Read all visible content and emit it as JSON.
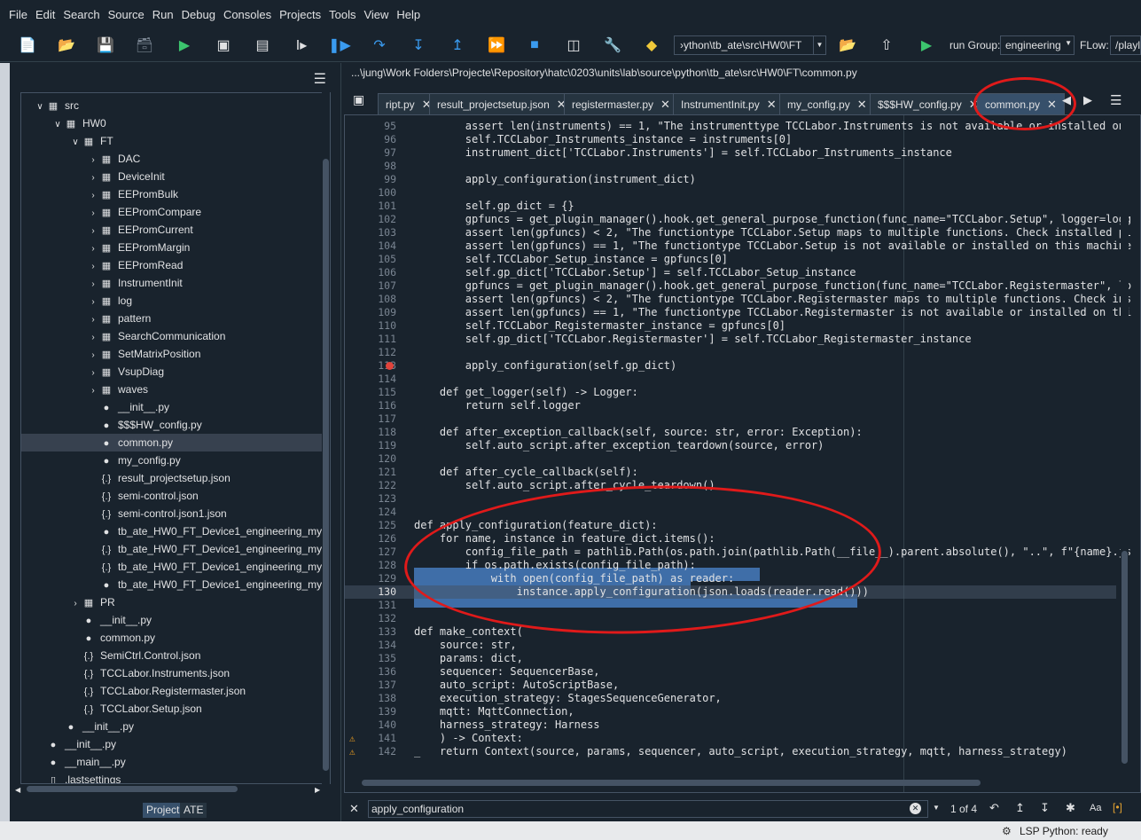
{
  "menu": [
    "File",
    "Edit",
    "Search",
    "Source",
    "Run",
    "Debug",
    "Consoles",
    "Projects",
    "Tools",
    "View",
    "Help"
  ],
  "toolbar": {
    "path": "›ython\\tb_ate\\src\\HW0\\FT",
    "run_group_label": "run Group:",
    "run_group_value": "engineering",
    "flow_label": "FLow:",
    "flow_value": "/playlis"
  },
  "tree": [
    {
      "label": "src",
      "indent": 1,
      "chev": "v",
      "icon": "folder"
    },
    {
      "label": "HW0",
      "indent": 2,
      "chev": "v",
      "icon": "folder"
    },
    {
      "label": "FT",
      "indent": 3,
      "chev": "v",
      "icon": "folder"
    },
    {
      "label": "DAC",
      "indent": 4,
      "chev": ">",
      "icon": "folder"
    },
    {
      "label": "DeviceInit",
      "indent": 4,
      "chev": ">",
      "icon": "folder"
    },
    {
      "label": "EEPromBulk",
      "indent": 4,
      "chev": ">",
      "icon": "folder"
    },
    {
      "label": "EEPromCompare",
      "indent": 4,
      "chev": ">",
      "icon": "folder"
    },
    {
      "label": "EEPromCurrent",
      "indent": 4,
      "chev": ">",
      "icon": "folder"
    },
    {
      "label": "EEPromMargin",
      "indent": 4,
      "chev": ">",
      "icon": "folder"
    },
    {
      "label": "EEPromRead",
      "indent": 4,
      "chev": ">",
      "icon": "folder"
    },
    {
      "label": "InstrumentInit",
      "indent": 4,
      "chev": ">",
      "icon": "folder"
    },
    {
      "label": "log",
      "indent": 4,
      "chev": ">",
      "icon": "folder"
    },
    {
      "label": "pattern",
      "indent": 4,
      "chev": ">",
      "icon": "folder"
    },
    {
      "label": "SearchCommunication",
      "indent": 4,
      "chev": ">",
      "icon": "folder"
    },
    {
      "label": "SetMatrixPosition",
      "indent": 4,
      "chev": ">",
      "icon": "folder"
    },
    {
      "label": "VsupDiag",
      "indent": 4,
      "chev": ">",
      "icon": "folder"
    },
    {
      "label": "waves",
      "indent": 4,
      "chev": ">",
      "icon": "folder"
    },
    {
      "label": "__init__.py",
      "indent": 4,
      "chev": "",
      "icon": "py"
    },
    {
      "label": "$$$HW_config.py",
      "indent": 4,
      "chev": "",
      "icon": "py"
    },
    {
      "label": "common.py",
      "indent": 4,
      "chev": "",
      "icon": "py",
      "selected": true
    },
    {
      "label": "my_config.py",
      "indent": 4,
      "chev": "",
      "icon": "py"
    },
    {
      "label": "result_projectsetup.json",
      "indent": 4,
      "chev": "",
      "icon": "json"
    },
    {
      "label": "semi-control.json",
      "indent": 4,
      "chev": "",
      "icon": "json"
    },
    {
      "label": "semi-control.json1.json",
      "indent": 4,
      "chev": "",
      "icon": "json"
    },
    {
      "label": "tb_ate_HW0_FT_Device1_engineering_myp",
      "indent": 4,
      "chev": "",
      "icon": "py"
    },
    {
      "label": "tb_ate_HW0_FT_Device1_engineering_myp",
      "indent": 4,
      "chev": "",
      "icon": "json"
    },
    {
      "label": "tb_ate_HW0_FT_Device1_engineering_myp",
      "indent": 4,
      "chev": "",
      "icon": "json"
    },
    {
      "label": "tb_ate_HW0_FT_Device1_engineering_myp",
      "indent": 4,
      "chev": "",
      "icon": "py"
    },
    {
      "label": "PR",
      "indent": 3,
      "chev": ">",
      "icon": "folder"
    },
    {
      "label": "__init__.py",
      "indent": 3,
      "chev": "",
      "icon": "py"
    },
    {
      "label": "common.py",
      "indent": 3,
      "chev": "",
      "icon": "py"
    },
    {
      "label": "SemiCtrl.Control.json",
      "indent": 3,
      "chev": "",
      "icon": "json"
    },
    {
      "label": "TCCLabor.Instruments.json",
      "indent": 3,
      "chev": "",
      "icon": "json"
    },
    {
      "label": "TCCLabor.Registermaster.json",
      "indent": 3,
      "chev": "",
      "icon": "json"
    },
    {
      "label": "TCCLabor.Setup.json",
      "indent": 3,
      "chev": "",
      "icon": "json"
    },
    {
      "label": "__init__.py",
      "indent": 2,
      "chev": "",
      "icon": "py"
    },
    {
      "label": "__init__.py",
      "indent": 1,
      "chev": "",
      "icon": "py"
    },
    {
      "label": "__main__.py",
      "indent": 1,
      "chev": "",
      "icon": "py"
    },
    {
      "label": ".lastsettings",
      "indent": 1,
      "chev": "",
      "icon": "file"
    }
  ],
  "panel_tabs": [
    "Project",
    "ATE"
  ],
  "editor": {
    "path": "...\\jung\\Work Folders\\Projecte\\Repository\\hatc\\0203\\units\\lab\\source\\python\\tb_ate\\src\\HW0\\FT\\common.py",
    "tabs": [
      {
        "label": "ript.py"
      },
      {
        "label": "result_projectsetup.json"
      },
      {
        "label": "registermaster.py"
      },
      {
        "label": "InstrumentInit.py"
      },
      {
        "label": "my_config.py"
      },
      {
        "label": "$$$HW_config.py"
      },
      {
        "label": "common.py",
        "active": true
      }
    ],
    "lines": [
      {
        "n": "95",
        "t": "        assert len(instruments) == 1, \"The instrumenttype TCCLabor.Instruments is not available or installed on"
      },
      {
        "n": "96",
        "t": "        self.TCCLabor_Instruments_instance = instruments[0]"
      },
      {
        "n": "97",
        "t": "        instrument_dict['TCCLabor.Instruments'] = self.TCCLabor_Instruments_instance"
      },
      {
        "n": "98",
        "t": ""
      },
      {
        "n": "99",
        "t": "        apply_configuration(instrument_dict)"
      },
      {
        "n": "100",
        "t": ""
      },
      {
        "n": "101",
        "t": "        self.gp_dict = {}"
      },
      {
        "n": "102",
        "t": "        gpfuncs = get_plugin_manager().hook.get_general_purpose_function(func_name=\"TCCLabor.Setup\", logger=logg"
      },
      {
        "n": "103",
        "t": "        assert len(gpfuncs) < 2, \"The functiontype TCCLabor.Setup maps to multiple functions. Check installed pl"
      },
      {
        "n": "104",
        "t": "        assert len(gpfuncs) == 1, \"The functiontype TCCLabor.Setup is not available or installed on this machine"
      },
      {
        "n": "105",
        "t": "        self.TCCLabor_Setup_instance = gpfuncs[0]"
      },
      {
        "n": "106",
        "t": "        self.gp_dict['TCCLabor.Setup'] = self.TCCLabor_Setup_instance"
      },
      {
        "n": "107",
        "t": "        gpfuncs = get_plugin_manager().hook.get_general_purpose_function(func_name=\"TCCLabor.Registermaster\", lo"
      },
      {
        "n": "108",
        "t": "        assert len(gpfuncs) < 2, \"The functiontype TCCLabor.Registermaster maps to multiple functions. Check ins"
      },
      {
        "n": "109",
        "t": "        assert len(gpfuncs) == 1, \"The functiontype TCCLabor.Registermaster is not available or installed on thi"
      },
      {
        "n": "110",
        "t": "        self.TCCLabor_Registermaster_instance = gpfuncs[0]"
      },
      {
        "n": "111",
        "t": "        self.gp_dict['TCCLabor.Registermaster'] = self.TCCLabor_Registermaster_instance"
      },
      {
        "n": "112",
        "t": ""
      },
      {
        "n": "113",
        "t": "        apply_configuration(self.gp_dict)",
        "bp": true
      },
      {
        "n": "114",
        "t": ""
      },
      {
        "n": "115",
        "t": "    def get_logger(self) -> Logger:"
      },
      {
        "n": "116",
        "t": "        return self.logger"
      },
      {
        "n": "117",
        "t": ""
      },
      {
        "n": "118",
        "t": "    def after_exception_callback(self, source: str, error: Exception):"
      },
      {
        "n": "119",
        "t": "        self.auto_script.after_exception_teardown(source, error)"
      },
      {
        "n": "120",
        "t": ""
      },
      {
        "n": "121",
        "t": "    def after_cycle_callback(self):"
      },
      {
        "n": "122",
        "t": "        self.auto_script.after_cycle_teardown()"
      },
      {
        "n": "123",
        "t": ""
      },
      {
        "n": "124",
        "t": ""
      },
      {
        "n": "125",
        "t": "def apply_configuration(feature_dict):"
      },
      {
        "n": "126",
        "t": "    for name, instance in feature_dict.items():"
      },
      {
        "n": "127",
        "t": "        config_file_path = pathlib.Path(os.path.join(pathlib.Path(__file__).parent.absolute(), \"..\", f\"{name}.js"
      },
      {
        "n": "128",
        "t": "        if os.path.exists(config_file_path):"
      },
      {
        "n": "129",
        "t": "            with open(config_file_path) as reader:"
      },
      {
        "n": "130",
        "t": "                instance.apply_configuration(json.loads(reader.read()))",
        "cur": true
      },
      {
        "n": "131",
        "t": ""
      },
      {
        "n": "132",
        "t": ""
      },
      {
        "n": "133",
        "t": "def make_context("
      },
      {
        "n": "134",
        "t": "    source: str,"
      },
      {
        "n": "135",
        "t": "    params: dict,"
      },
      {
        "n": "136",
        "t": "    sequencer: SequencerBase,"
      },
      {
        "n": "137",
        "t": "    auto_script: AutoScriptBase,"
      },
      {
        "n": "138",
        "t": "    execution_strategy: StagesSequenceGenerator,"
      },
      {
        "n": "139",
        "t": "    mqtt: MqttConnection,"
      },
      {
        "n": "140",
        "t": "    harness_strategy: Harness"
      },
      {
        "n": "141",
        "t": "    ) -> Context:",
        "warn": true
      },
      {
        "n": "142",
        "t": "_   return Context(source, params, sequencer, auto_script, execution_strategy, mqtt, harness_strategy)",
        "warn": true
      }
    ]
  },
  "find": {
    "value": "apply_configuration",
    "count": "1 of 4",
    "case_label": "Aa"
  },
  "status": {
    "lsp": "LSP Python: ready"
  }
}
